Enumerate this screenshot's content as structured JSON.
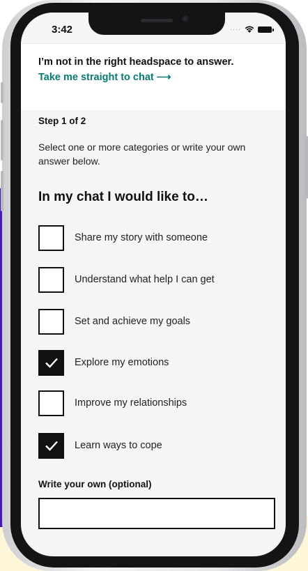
{
  "status_bar": {
    "time": "3:42"
  },
  "top_card": {
    "headline": "I’m not in the right headspace to answer.",
    "chat_link": "Take me straight to chat ⟶"
  },
  "step": "Step 1 of 2",
  "instructions": "Select one or more categories or write your own answer below.",
  "question": "In my chat I would like to…",
  "options": [
    {
      "label": "Share my story with someone",
      "checked": false
    },
    {
      "label": "Understand what help I can get",
      "checked": false
    },
    {
      "label": "Set and achieve my goals",
      "checked": false
    },
    {
      "label": "Explore my emotions",
      "checked": true
    },
    {
      "label": "Improve my relationships",
      "checked": false
    },
    {
      "label": "Learn ways to cope",
      "checked": true
    }
  ],
  "write_own": {
    "label": "Write your own (optional)",
    "value": "",
    "placeholder": ""
  },
  "colors": {
    "link": "#0b7a74",
    "purple_panel": "#4a16b8",
    "yellow_panel": "#fdf6d8"
  }
}
